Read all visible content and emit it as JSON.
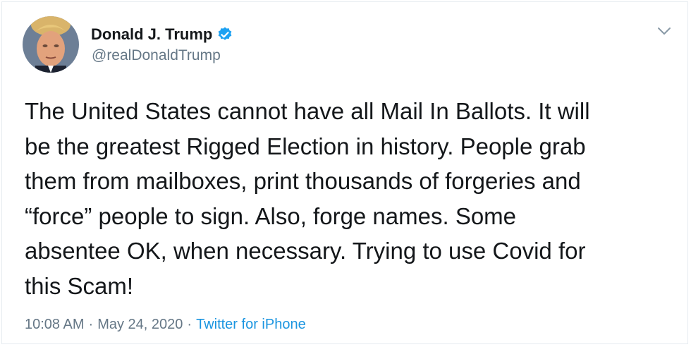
{
  "author": {
    "display_name": "Donald J. Trump",
    "handle": "@realDonaldTrump",
    "verified": true,
    "verified_color": "#1da1f2"
  },
  "tweet": {
    "text_lines": [
      "The United States cannot have all Mail In Ballots. It will",
      "be the greatest Rigged Election in history. People grab",
      "them from mailboxes, print thousands of forgeries and",
      "“force” people to sign. Also, forge names. Some",
      "absentee OK, when necessary. Trying to use Covid for",
      "this Scam!"
    ]
  },
  "meta": {
    "time": "10:08 AM",
    "separator": "·",
    "date": "May 24, 2020",
    "source": "Twitter for iPhone",
    "source_color": "#1b95e0"
  },
  "icons": {
    "verified": "verified-badge-icon",
    "menu": "chevron-down-icon"
  }
}
